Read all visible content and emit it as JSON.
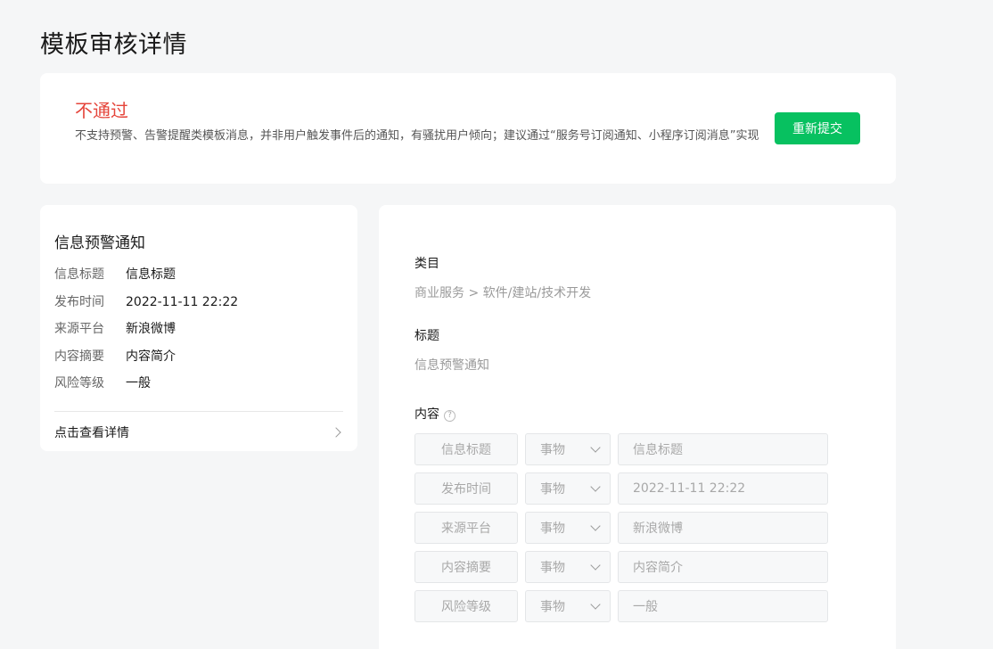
{
  "page": {
    "title": "模板审核详情"
  },
  "status": {
    "title": "不通过",
    "description": "不支持预警、告警提醒类模板消息，并非用户触发事件后的通知，有骚扰用户倾向；建议通过“服务号订阅通知、小程序订阅消息”实现",
    "resubmit_label": "重新提交"
  },
  "preview": {
    "title": "信息预警通知",
    "rows": [
      {
        "key": "信息标题",
        "value": "信息标题"
      },
      {
        "key": "发布时间",
        "value": "2022-11-11 22:22"
      },
      {
        "key": "来源平台",
        "value": "新浪微博"
      },
      {
        "key": "内容摘要",
        "value": "内容简介"
      },
      {
        "key": "风险等级",
        "value": "一般"
      }
    ],
    "detail_link": "点击查看详情"
  },
  "detail": {
    "category_label": "类目",
    "category_value": "商业服务 > 软件/建站/技术开发",
    "title_label": "标题",
    "title_value": "信息预警通知",
    "content_label": "内容",
    "help_glyph": "?",
    "content_rows": [
      {
        "name": "信息标题",
        "type": "事物",
        "value": "信息标题"
      },
      {
        "name": "发布时间",
        "type": "事物",
        "value": "2022-11-11 22:22"
      },
      {
        "name": "来源平台",
        "type": "事物",
        "value": "新浪微博"
      },
      {
        "name": "内容摘要",
        "type": "事物",
        "value": "内容简介"
      },
      {
        "name": "风险等级",
        "type": "事物",
        "value": "一般"
      }
    ]
  },
  "colors": {
    "accent": "#07c160",
    "error": "#e5453b",
    "background": "#f5f6f7"
  },
  "icons": {
    "detail_chevron": "chevron-right-icon",
    "select_chevron": "chevron-down-icon",
    "help": "help-circle-icon"
  }
}
